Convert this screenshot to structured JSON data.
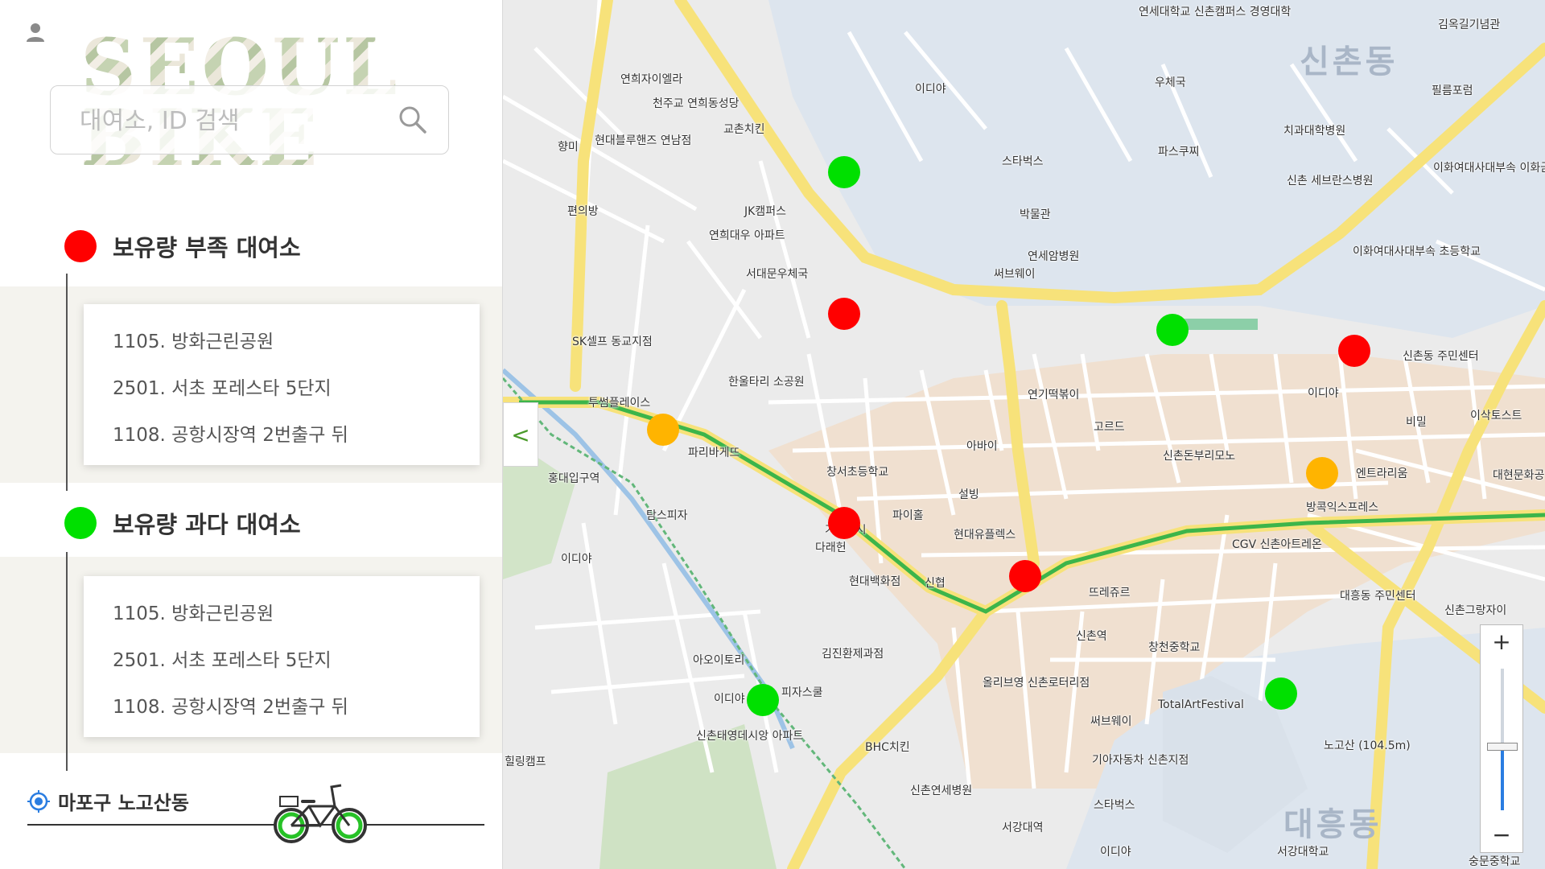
{
  "search": {
    "placeholder": "대여소, ID 검색"
  },
  "colors": {
    "shortage": "#ff0000",
    "surplus": "#00e000",
    "warning": "#ffb400",
    "accent": "#2a7de1"
  },
  "sections": [
    {
      "title": "보유량 부족 대여소",
      "dot_color": "#ff0000",
      "items": [
        "1105. 방화근린공원",
        "2501. 서초 포레스타 5단지",
        "1108. 공항시장역 2번출구 뒤"
      ]
    },
    {
      "title": "보유량 과다 대여소",
      "dot_color": "#00e000",
      "items": [
        "1105. 방화근린공원",
        "2501. 서초 포레스타 5단지",
        "1108. 공항시장역 2번출구 뒤"
      ]
    }
  ],
  "location": {
    "label": "마포구 노고산동"
  },
  "map": {
    "collapse_label": "<",
    "zoom_in_label": "+",
    "zoom_out_label": "−",
    "zoom_level": 0.45,
    "districts": [
      "신촌동",
      "대흥동"
    ],
    "labels": [
      "연세대학교 신촌캠퍼스 경영대학",
      "김옥길기념관",
      "이디야",
      "우체국",
      "필름포럼",
      "연희자이엘라",
      "천주교 연희동성당",
      "교촌치킨",
      "치과대학병원",
      "현대블루핸즈 연남점",
      "향미",
      "파스쿠찌",
      "스타벅스",
      "신촌 세브란스병원",
      "이화여대사대부속 이화금란중학교",
      "편의방",
      "JK캠퍼스",
      "박물관",
      "연희대우 아파트",
      "서대문우체국",
      "써브웨이",
      "연세암병원",
      "이화여대사대부속 초등학교",
      "SK셀프 동교지점",
      "한울타리 소공원",
      "신촌동 주민센터",
      "투썸플레이스",
      "연기떡볶이",
      "이디야",
      "고르드",
      "비밀",
      "이삭토스트",
      "파리바게뜨",
      "아바이",
      "신촌돈부리모노",
      "홍대입구역",
      "창서초등학교",
      "설빙",
      "엔트라리움",
      "대현문화공원",
      "탐스피자",
      "파이홀",
      "방콕익스프레스",
      "기꾸스시",
      "현대유플렉스",
      "CGV 신촌아트레온",
      "다래헌",
      "이디야",
      "신협",
      "현대백화점",
      "뜨레쥬르",
      "대흥동 주민센터",
      "신촌그랑자이",
      "신촌역",
      "창천중학교",
      "아오이토리",
      "김진환제과점",
      "올리브영 신촌로터리점",
      "TotalArtFestival",
      "피자스쿨",
      "이디야",
      "써브웨이",
      "노고산 (104.5m)",
      "신촌태영데시앙 아파트",
      "BHC치킨",
      "기아자동차 신촌지점",
      "힐링캠프",
      "신촌연세병원",
      "스타벅스",
      "서강대역",
      "이디야",
      "서강대학교",
      "숭문중학교"
    ],
    "stations": [
      {
        "status": "surplus"
      },
      {
        "status": "shortage"
      },
      {
        "status": "surplus"
      },
      {
        "status": "shortage"
      },
      {
        "status": "warning"
      },
      {
        "status": "shortage"
      },
      {
        "status": "warning"
      },
      {
        "status": "shortage"
      },
      {
        "status": "surplus"
      },
      {
        "status": "surplus"
      }
    ]
  }
}
